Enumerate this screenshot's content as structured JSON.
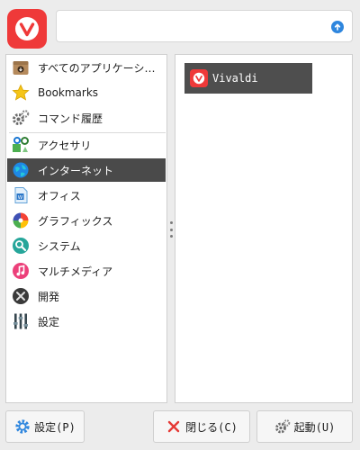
{
  "search": {
    "value": "",
    "placeholder": ""
  },
  "categories": [
    {
      "label": "すべてのアプリケーション",
      "icon": "all-apps-icon",
      "selected": false
    },
    {
      "label": "Bookmarks",
      "icon": "star-icon",
      "selected": false
    },
    {
      "label": "コマンド履歴",
      "icon": "gears-icon",
      "selected": false
    },
    {
      "label": "アクセサリ",
      "icon": "accessories-icon",
      "selected": false
    },
    {
      "label": "インターネット",
      "icon": "globe-icon",
      "selected": true
    },
    {
      "label": "オフィス",
      "icon": "document-icon",
      "selected": false
    },
    {
      "label": "グラフィックス",
      "icon": "color-wheel-icon",
      "selected": false
    },
    {
      "label": "システム",
      "icon": "magnifier-icon",
      "selected": false
    },
    {
      "label": "マルチメディア",
      "icon": "music-note-icon",
      "selected": false
    },
    {
      "label": "開発",
      "icon": "tools-icon",
      "selected": false
    },
    {
      "label": "設定",
      "icon": "sliders-icon",
      "selected": false
    }
  ],
  "apps": [
    {
      "label": "Vivaldi",
      "icon": "vivaldi-icon"
    }
  ],
  "buttons": {
    "settings": "設定(P)",
    "close": "閉じる(C)",
    "launch": "起動(U)"
  },
  "colors": {
    "brand": "#ef3939",
    "selected_bg": "#4a4a4a",
    "accent_blue": "#2e86de"
  }
}
